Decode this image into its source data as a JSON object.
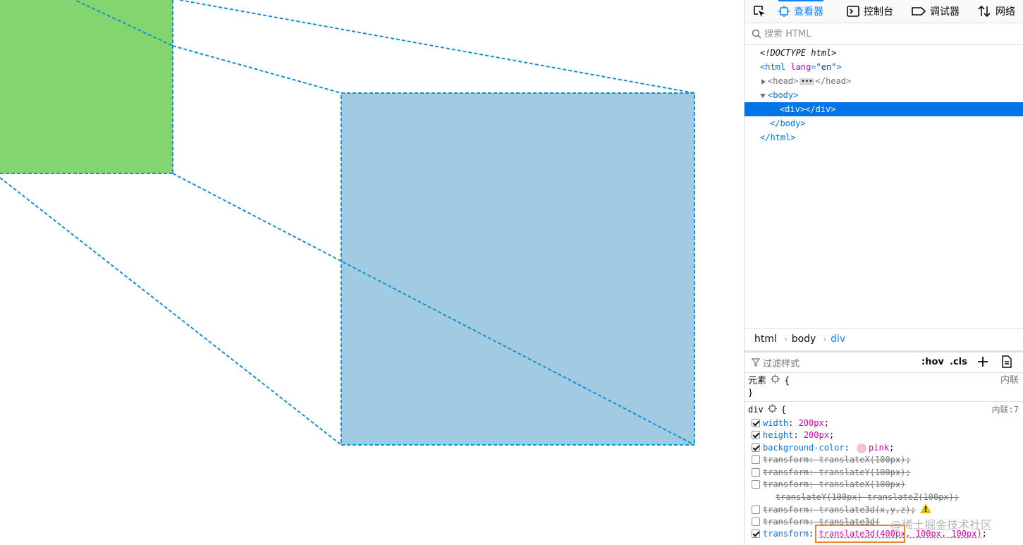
{
  "viewport": {
    "green_color": "#82d56f",
    "blue_color": "#a0cbe3",
    "guide_color": "#1590d0"
  },
  "toolbar": {
    "tabs": [
      {
        "label": "查看器",
        "icon": "inspector-icon"
      },
      {
        "label": "控制台",
        "icon": "console-icon"
      },
      {
        "label": "调试器",
        "icon": "debugger-icon"
      },
      {
        "label": "网络",
        "icon": "network-icon"
      }
    ]
  },
  "search": {
    "placeholder": "搜索 HTML"
  },
  "markup": {
    "doctype": "<!DOCTYPE html>",
    "html_open": "<html",
    "lang_attr": "lang",
    "lang_val": "\"en\"",
    "html_close_bracket": ">",
    "head_open": "<head>",
    "head_close": "</head>",
    "body_open": "<body>",
    "div": "<div></div>",
    "body_close": "</body>",
    "html_close": "</html>"
  },
  "breadcrumb": [
    "html",
    "body",
    "div"
  ],
  "rules_toolbar": {
    "filter_placeholder": "过滤样式",
    "hov": ":hov",
    "cls": ".cls"
  },
  "rules": {
    "element": {
      "selector": "元素",
      "brace_open": "{",
      "brace_close": "}",
      "origin": "内联"
    },
    "div": {
      "selector": "div",
      "brace_open": "{",
      "origin": "内联:7",
      "decls": [
        {
          "name": "width",
          "value": "200px",
          "enabled": true
        },
        {
          "name": "height",
          "value": "200px",
          "enabled": true
        },
        {
          "name": "background-color",
          "value": "pink",
          "enabled": true
        },
        {
          "name": "transform",
          "value": "translateX(100px)",
          "enabled": false
        },
        {
          "name": "transform",
          "value": "translateY(100px)",
          "enabled": false
        },
        {
          "name": "transform",
          "value": "translateX(100px)",
          "enabled": false
        },
        {
          "name": "",
          "value": "translateY(100px) translateZ(100px)",
          "enabled": false
        },
        {
          "name": "transform",
          "value": "translate3d(x,y,z)",
          "enabled": false
        },
        {
          "name": "transform",
          "value": "translate3d(",
          "enabled": false
        },
        {
          "name": "transform",
          "value": "translate3d(400px, 100px, 100px)",
          "enabled": true
        }
      ],
      "brace_close": "}"
    }
  },
  "watermark": "@稀土掘金技术社区"
}
